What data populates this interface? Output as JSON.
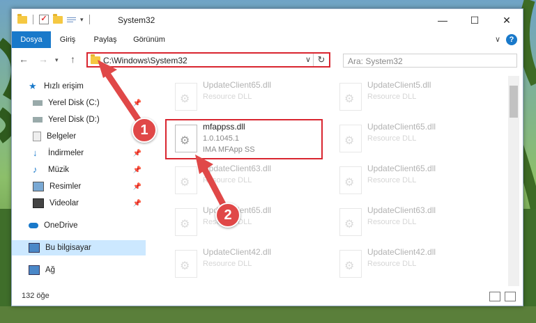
{
  "window": {
    "title": "System32"
  },
  "ribbon": {
    "tabs": [
      "Dosya",
      "Giriş",
      "Paylaş",
      "Görünüm"
    ],
    "help": "?"
  },
  "address": {
    "path": "C:\\Windows\\System32",
    "search_placeholder": "Ara: System32"
  },
  "nav": {
    "items": [
      {
        "label": "Hızlı erişim",
        "icon": "star-icon"
      },
      {
        "label": "Yerel Disk (C:)",
        "icon": "drive-icon",
        "pinned": true
      },
      {
        "label": "Yerel Disk (D:)",
        "icon": "drive-icon"
      },
      {
        "label": "Belgeler",
        "icon": "documents-icon"
      },
      {
        "label": "İndirmeler",
        "icon": "download-icon",
        "pinned": true
      },
      {
        "label": "Müzik",
        "icon": "music-icon",
        "pinned": true
      },
      {
        "label": "Resimler",
        "icon": "pictures-icon",
        "pinned": true
      },
      {
        "label": "Videolar",
        "icon": "videos-icon",
        "pinned": true
      },
      {
        "label": "OneDrive",
        "icon": "cloud-icon"
      },
      {
        "label": "Bu bilgisayar",
        "icon": "computer-icon",
        "selected": true
      },
      {
        "label": "Ağ",
        "icon": "network-icon"
      }
    ]
  },
  "files": [
    {
      "name": "UpdateClient65.dll",
      "type": "Resource DLL"
    },
    {
      "name": "UpdateClient5.dll",
      "type": "Resource DLL"
    },
    {
      "name": "mfappss.dll",
      "version": "1.0.1045.1",
      "product": "IMA MFApp SS"
    },
    {
      "name": "UpdateClient65.dll",
      "type": "Resource DLL"
    },
    {
      "name": "UpdateClient63.dll",
      "type": "Resource DLL"
    },
    {
      "name": "UpdateClient65.dll",
      "type": "Resource DLL"
    },
    {
      "name": "UpdateClient65.dll",
      "type": "Resource DLL"
    },
    {
      "name": "UpdateClient63.dll",
      "type": "Resource DLL"
    },
    {
      "name": "UpdateClient42.dll",
      "type": "Resource DLL"
    },
    {
      "name": "UpdateClient42.dll",
      "type": "Resource DLL"
    }
  ],
  "status": {
    "count": "132 öğe"
  },
  "callouts": [
    "1",
    "2"
  ],
  "colors": {
    "accent": "#1979ca",
    "highlight": "#d9252f",
    "callout": "#e04848"
  }
}
